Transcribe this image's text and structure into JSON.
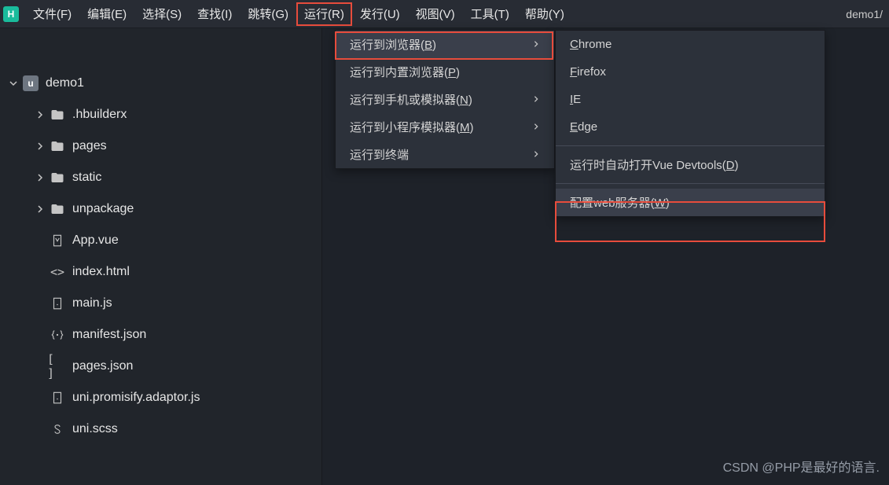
{
  "menubar": {
    "items": [
      {
        "label": "文件(F)"
      },
      {
        "label": "编辑(E)"
      },
      {
        "label": "选择(S)"
      },
      {
        "label": "查找(I)"
      },
      {
        "label": "跳转(G)"
      },
      {
        "label": "运行(R)",
        "highlighted": true
      },
      {
        "label": "发行(U)"
      },
      {
        "label": "视图(V)"
      },
      {
        "label": "工具(T)"
      },
      {
        "label": "帮助(Y)"
      }
    ],
    "right_text": "demo1/"
  },
  "sidebar": {
    "project_name": "demo1",
    "items": [
      {
        "type": "folder",
        "expandable": true,
        "label": ".hbuilderx"
      },
      {
        "type": "folder",
        "expandable": true,
        "label": "pages"
      },
      {
        "type": "folder",
        "expandable": true,
        "label": "static"
      },
      {
        "type": "folder",
        "expandable": true,
        "label": "unpackage"
      },
      {
        "type": "vue",
        "expandable": false,
        "label": "App.vue"
      },
      {
        "type": "html",
        "expandable": false,
        "label": "index.html"
      },
      {
        "type": "js",
        "expandable": false,
        "label": "main.js"
      },
      {
        "type": "json",
        "expandable": false,
        "label": "manifest.json"
      },
      {
        "type": "json2",
        "expandable": false,
        "label": "pages.json"
      },
      {
        "type": "js",
        "expandable": false,
        "label": "uni.promisify.adaptor.js"
      },
      {
        "type": "scss",
        "expandable": false,
        "label": "uni.scss"
      }
    ]
  },
  "run_menu": {
    "items": [
      {
        "pre": "运行到浏览器(",
        "u": "B",
        "post": ")",
        "arrow": true,
        "hover": true
      },
      {
        "pre": "运行到内置浏览器(",
        "u": "P",
        "post": ")",
        "arrow": false
      },
      {
        "pre": "运行到手机或模拟器(",
        "u": "N",
        "post": ")",
        "arrow": true
      },
      {
        "pre": "运行到小程序模拟器(",
        "u": "M",
        "post": ")",
        "arrow": true
      },
      {
        "pre": "运行到终端",
        "u": "",
        "post": "",
        "arrow": true
      }
    ]
  },
  "sub_menu": {
    "group1": [
      {
        "pre": "",
        "u": "C",
        "post": "hrome"
      },
      {
        "pre": "",
        "u": "F",
        "post": "irefox"
      },
      {
        "pre": "",
        "u": "I",
        "post": "E"
      },
      {
        "pre": "",
        "u": "E",
        "post": "dge"
      }
    ],
    "group2": [
      {
        "pre": "运行时自动打开Vue Devtools(",
        "u": "D",
        "post": ")"
      }
    ],
    "group3": [
      {
        "pre": "配置web服务器(",
        "u": "W",
        "post": ")",
        "hover": true
      }
    ]
  },
  "watermark": "CSDN @PHP是最好的语言."
}
